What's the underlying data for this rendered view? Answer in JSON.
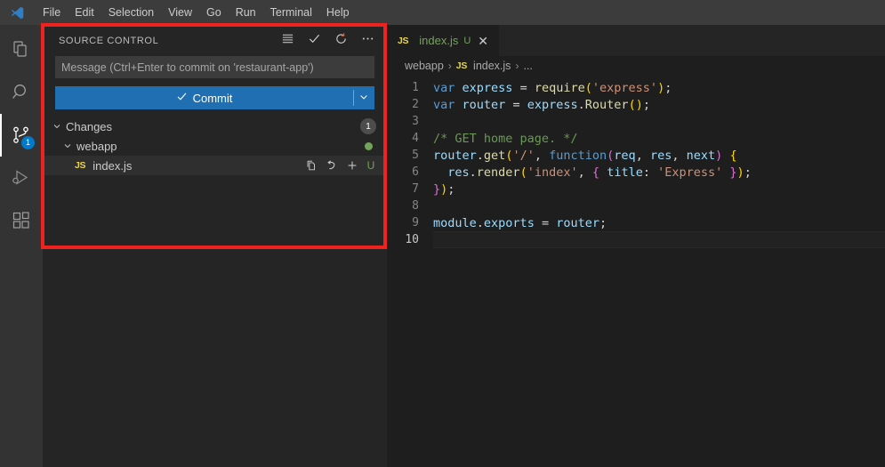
{
  "titlebar": {
    "logo_icon": "vscode-logo-icon",
    "menus": [
      "File",
      "Edit",
      "Selection",
      "View",
      "Go",
      "Run",
      "Terminal",
      "Help"
    ]
  },
  "activitybar": {
    "items": [
      {
        "name": "explorer",
        "icon": "files-icon",
        "active": false,
        "badge": ""
      },
      {
        "name": "search",
        "icon": "search-icon",
        "active": false,
        "badge": ""
      },
      {
        "name": "source-control",
        "icon": "source-control-icon",
        "active": true,
        "badge": "1"
      },
      {
        "name": "run-and-debug",
        "icon": "run-debug-icon",
        "active": false,
        "badge": ""
      },
      {
        "name": "extensions",
        "icon": "extensions-icon",
        "active": false,
        "badge": ""
      }
    ]
  },
  "sidebar": {
    "title": "SOURCE CONTROL",
    "actions": [
      {
        "name": "view-as-list",
        "icon": "list-icon"
      },
      {
        "name": "commit",
        "icon": "check-icon"
      },
      {
        "name": "refresh",
        "icon": "refresh-icon"
      },
      {
        "name": "more-actions",
        "icon": "ellipsis-icon"
      }
    ],
    "commit_input": {
      "placeholder": "Message (Ctrl+Enter to commit on 'restaurant-app')",
      "value": ""
    },
    "commit_button": {
      "label": "Commit",
      "icon": "check-icon",
      "dropdown_icon": "chevron-down-icon",
      "color": "#1f6fb2"
    },
    "tree": {
      "group": {
        "label": "Changes",
        "count": "1",
        "chevron": "chevron-down-icon"
      },
      "folder": {
        "label": "webapp",
        "chevron": "chevron-down-icon",
        "dot_color": "#73a35a"
      },
      "file": {
        "label": "index.js",
        "file_icon": "JS",
        "status": "U",
        "status_color": "#73a35a",
        "actions": [
          {
            "name": "open-file",
            "icon": "open-file-icon"
          },
          {
            "name": "discard-changes",
            "icon": "discard-icon"
          },
          {
            "name": "stage-changes",
            "icon": "plus-icon"
          }
        ]
      }
    }
  },
  "editor": {
    "tab": {
      "label": "index.js",
      "file_icon": "JS",
      "dirty_marker": "U",
      "close_icon": "close-icon"
    },
    "breadcrumb": [
      {
        "label": "webapp",
        "icon": ""
      },
      {
        "label": "index.js",
        "icon": "JS"
      },
      {
        "label": "...",
        "icon": ""
      }
    ],
    "breadcrumb_separator": "›",
    "lines": [
      {
        "num": "1",
        "active": false
      },
      {
        "num": "2",
        "active": false
      },
      {
        "num": "3",
        "active": false
      },
      {
        "num": "4",
        "active": false
      },
      {
        "num": "5",
        "active": false
      },
      {
        "num": "6",
        "active": false
      },
      {
        "num": "7",
        "active": false
      },
      {
        "num": "8",
        "active": false
      },
      {
        "num": "9",
        "active": false
      },
      {
        "num": "10",
        "active": true
      }
    ],
    "code_text": {
      "l1": "var express = require('express');",
      "l2": "var router = express.Router();",
      "l3": "",
      "l4": "/* GET home page. */",
      "l5": "router.get('/', function(req, res, next) {",
      "l6": "  res.render('index', { title: 'Express' });",
      "l7": "});",
      "l8": "",
      "l9": "module.exports = router;",
      "l10": ""
    }
  },
  "annotation": {
    "name": "red-highlight-box",
    "color": "#f0221f"
  }
}
